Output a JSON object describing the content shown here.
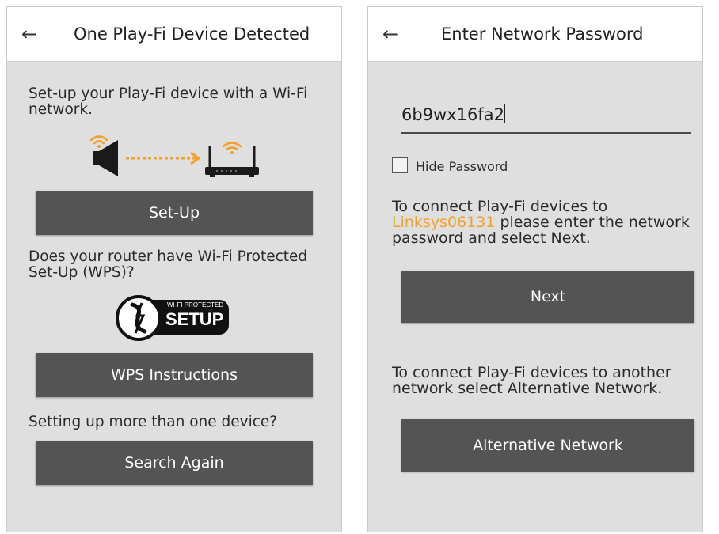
{
  "left_screen": {
    "title": "One Play-Fi Device Detected",
    "intro": "Set-up your Play-Fi device with a Wi-Fi network.",
    "setup_button": "Set-Up",
    "wps_question": "Does your router have Wi-Fi Protected Set-Up (WPS)?",
    "wps_logo_top": "WI-FI PROTECTED",
    "wps_logo_bottom": "SETUP",
    "wps_button": "WPS Instructions",
    "more_devices": "Setting up more than one device?",
    "search_button": "Search Again"
  },
  "right_screen": {
    "title": "Enter Network Password",
    "password_value": "6b9wx16fa2",
    "hide_password_label": "Hide Password",
    "hide_password_checked": false,
    "connect_text_before": "To connect Play-Fi devices to",
    "network_name": "Linksys06131",
    "connect_text_after": " please enter the network password and select Next.",
    "next_button": "Next",
    "alternative_text": "To connect Play-Fi devices to another network select Alternative Network.",
    "alternative_button": "Alternative Network"
  },
  "icons": {
    "back": "arrow-left-icon",
    "speaker": "speaker-icon",
    "router": "router-icon",
    "wifi": "wifi-icon",
    "wps_logo": "wps-logo"
  },
  "colors": {
    "accent": "#f0a12d",
    "button": "#545454",
    "background": "#dfdfdf",
    "appbar": "#ffffff"
  }
}
